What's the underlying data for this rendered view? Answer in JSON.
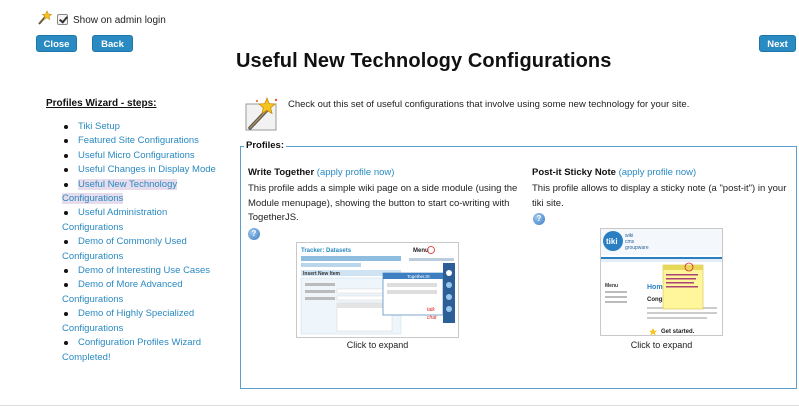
{
  "top": {
    "show_label": "Show on admin login",
    "close_label": "Close",
    "back_label": "Back",
    "next_label": "Next"
  },
  "page_title": "Useful New Technology Configurations",
  "sidebar": {
    "heading": "Profiles Wizard - steps:",
    "steps": [
      {
        "line1": "Tiki Setup",
        "line2": ""
      },
      {
        "line1": "Featured Site Configurations",
        "line2": ""
      },
      {
        "line1": "Useful Micro Configurations",
        "line2": ""
      },
      {
        "line1": "Useful Changes in Display Mode",
        "line2": ""
      },
      {
        "line1": "Useful New Technology",
        "line2": "Configurations"
      },
      {
        "line1": "Useful Administration",
        "line2": "Configurations"
      },
      {
        "line1": "Demo of Commonly Used",
        "line2": "Configurations"
      },
      {
        "line1": "Demo of Interesting Use Cases",
        "line2": ""
      },
      {
        "line1": "Demo of More Advanced",
        "line2": "Configurations"
      },
      {
        "line1": "Demo of Highly Specialized",
        "line2": "Configurations"
      },
      {
        "line1": "Configuration Profiles Wizard",
        "line2": "Completed!"
      }
    ]
  },
  "intro_text": "Check out this set of useful configurations that involve using some new technology for your site.",
  "profiles": {
    "legend": "Profiles:",
    "items": [
      {
        "title": "Write Together",
        "apply_link": "(apply profile now)",
        "description": "This profile adds a simple wiki page on a side module (using the Module menupage), showing the button to start co-writing with TogetherJS.",
        "expand": "Click to expand",
        "thumb": {
          "tracker_title": "Tracker: Datasets",
          "menu": "Menu",
          "insert": "Insert New Item",
          "popup_title": "TogetherJS",
          "talk": "talk",
          "chat": "chat"
        }
      },
      {
        "title": "Post-it Sticky Note",
        "apply_link": "(apply profile now)",
        "description": "This profile allows to display a sticky note (a \"post-it\") in your tiki site.",
        "expand": "Click to expand",
        "thumb": {
          "logo": "tiki",
          "brand1": "wiki",
          "brand2": "cms",
          "brand3": "groupware",
          "home": "HomeF",
          "congr": "Congr",
          "menu": "Menu",
          "get_started": "Get started."
        }
      }
    ]
  },
  "colors": {
    "accent": "#2a8ac2",
    "button_bg": "#2a8ac2",
    "border": "#5a9fce",
    "highlight": "#e6dcec"
  }
}
